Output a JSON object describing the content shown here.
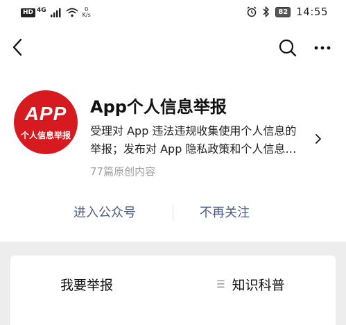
{
  "status_bar": {
    "hd": "HD",
    "network_type": "4G",
    "speed_value": "0",
    "speed_unit": "K/s",
    "battery": "82",
    "time": "14:55"
  },
  "nav": {
    "back_icon": "chevron-left-icon",
    "search_icon": "search-icon",
    "more_icon": "more-dots-icon"
  },
  "profile": {
    "avatar_text_top": "APP",
    "avatar_text_bottom": "个人信息举报",
    "name": "App个人信息举报",
    "description_line1": "受理对 App 违法违规收集使用个人信息的",
    "description_line2": "举报；发布对 App 隐私政策和个人信息…",
    "meta": "77篇原创内容"
  },
  "actions": {
    "enter": "进入公众号",
    "unfollow": "不再关注"
  },
  "menu": {
    "report": "我要举报",
    "knowledge": "知识科普",
    "knowledge_icon": "list-icon"
  },
  "colors": {
    "brand_red": "#d71920",
    "link_blue": "#4a5d86",
    "meta_gray": "#a0a0a0",
    "panel_bg": "#ededed"
  }
}
